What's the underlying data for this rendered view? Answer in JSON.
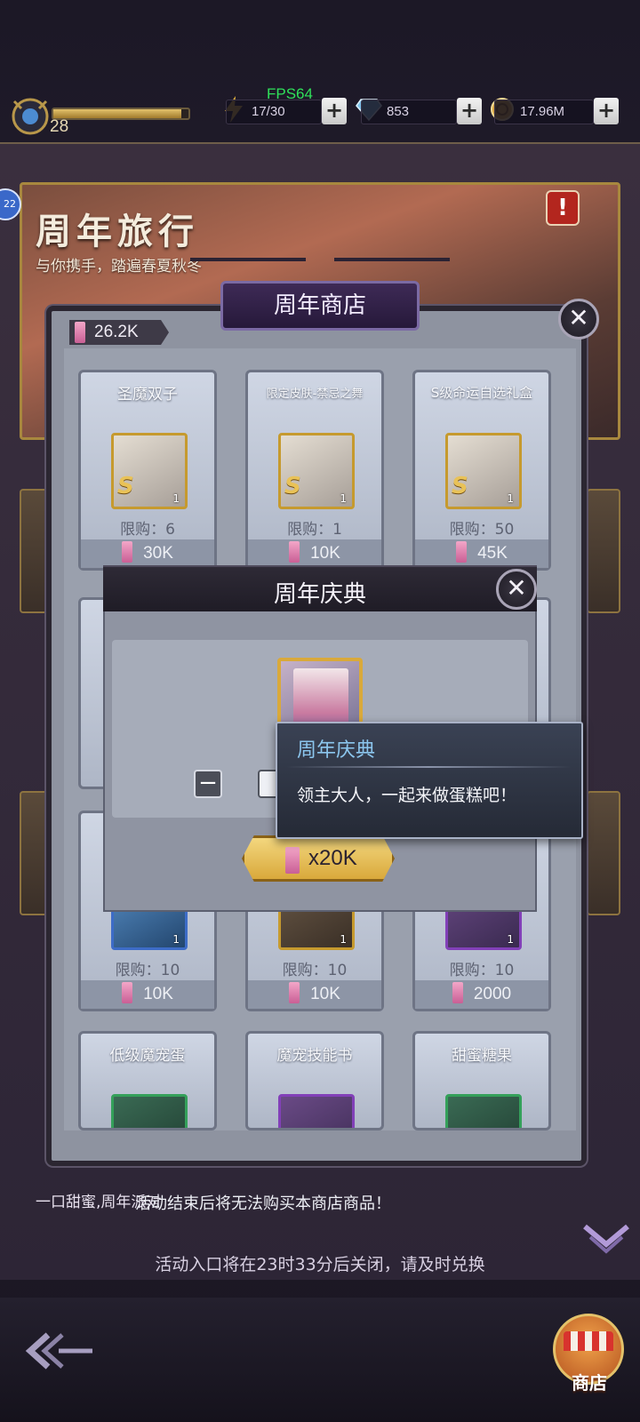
{
  "hud": {
    "fps": "FPS64",
    "level": "28",
    "xp_fraction": 0.95,
    "stamina": "17/30",
    "gems": "853",
    "gold": "17.96M"
  },
  "event": {
    "title": "周年旅行",
    "subtitle": "与你携手，踏遍春夏秋冬",
    "side_badge": "22",
    "alert": "!",
    "footer_note": "一口甜蜜,周年派对",
    "bottom_message": "活动入口将在23时33分后关闭，请及时兑换"
  },
  "shop": {
    "title": "周年商店",
    "currency_amount": "26.2K",
    "notice": "活动结束后将无法购买本商店商品！",
    "items": [
      {
        "name": "圣魔双子",
        "limit": "限购：6",
        "price": "30K",
        "qty": "1"
      },
      {
        "name": "限定皮肤-禁忌之舞",
        "limit": "限购：1",
        "price": "10K",
        "qty": "1"
      },
      {
        "name": "S级命运自选礼盒",
        "limit": "限购：50",
        "price": "45K",
        "qty": "1"
      },
      {
        "name": "",
        "limit": "限购：10",
        "price": "10K",
        "qty": "1"
      },
      {
        "name": "",
        "limit": "限购：10",
        "price": "10K",
        "qty": "1"
      },
      {
        "name": "",
        "limit": "限购：10",
        "price": "2000",
        "qty": "1"
      },
      {
        "name": "低级魔宠蛋",
        "limit": "",
        "price": "",
        "qty": ""
      },
      {
        "name": "魔宠技能书",
        "limit": "",
        "price": "",
        "qty": ""
      },
      {
        "name": "甜蜜糖果",
        "limit": "",
        "price": "",
        "qty": ""
      }
    ]
  },
  "dialog": {
    "title": "周年庆典",
    "minus_label": "−",
    "buy_price": "x20K"
  },
  "tooltip": {
    "title": "周年庆典",
    "text": "领主大人，一起来做蛋糕吧！"
  },
  "nav": {
    "shop_label": "商店"
  },
  "icons": {
    "stamina": "lightning-icon",
    "gems": "gem-icon",
    "gold": "coin-icon",
    "close": "close-icon",
    "back": "back-arrow-icon",
    "shop": "shop-icon"
  }
}
